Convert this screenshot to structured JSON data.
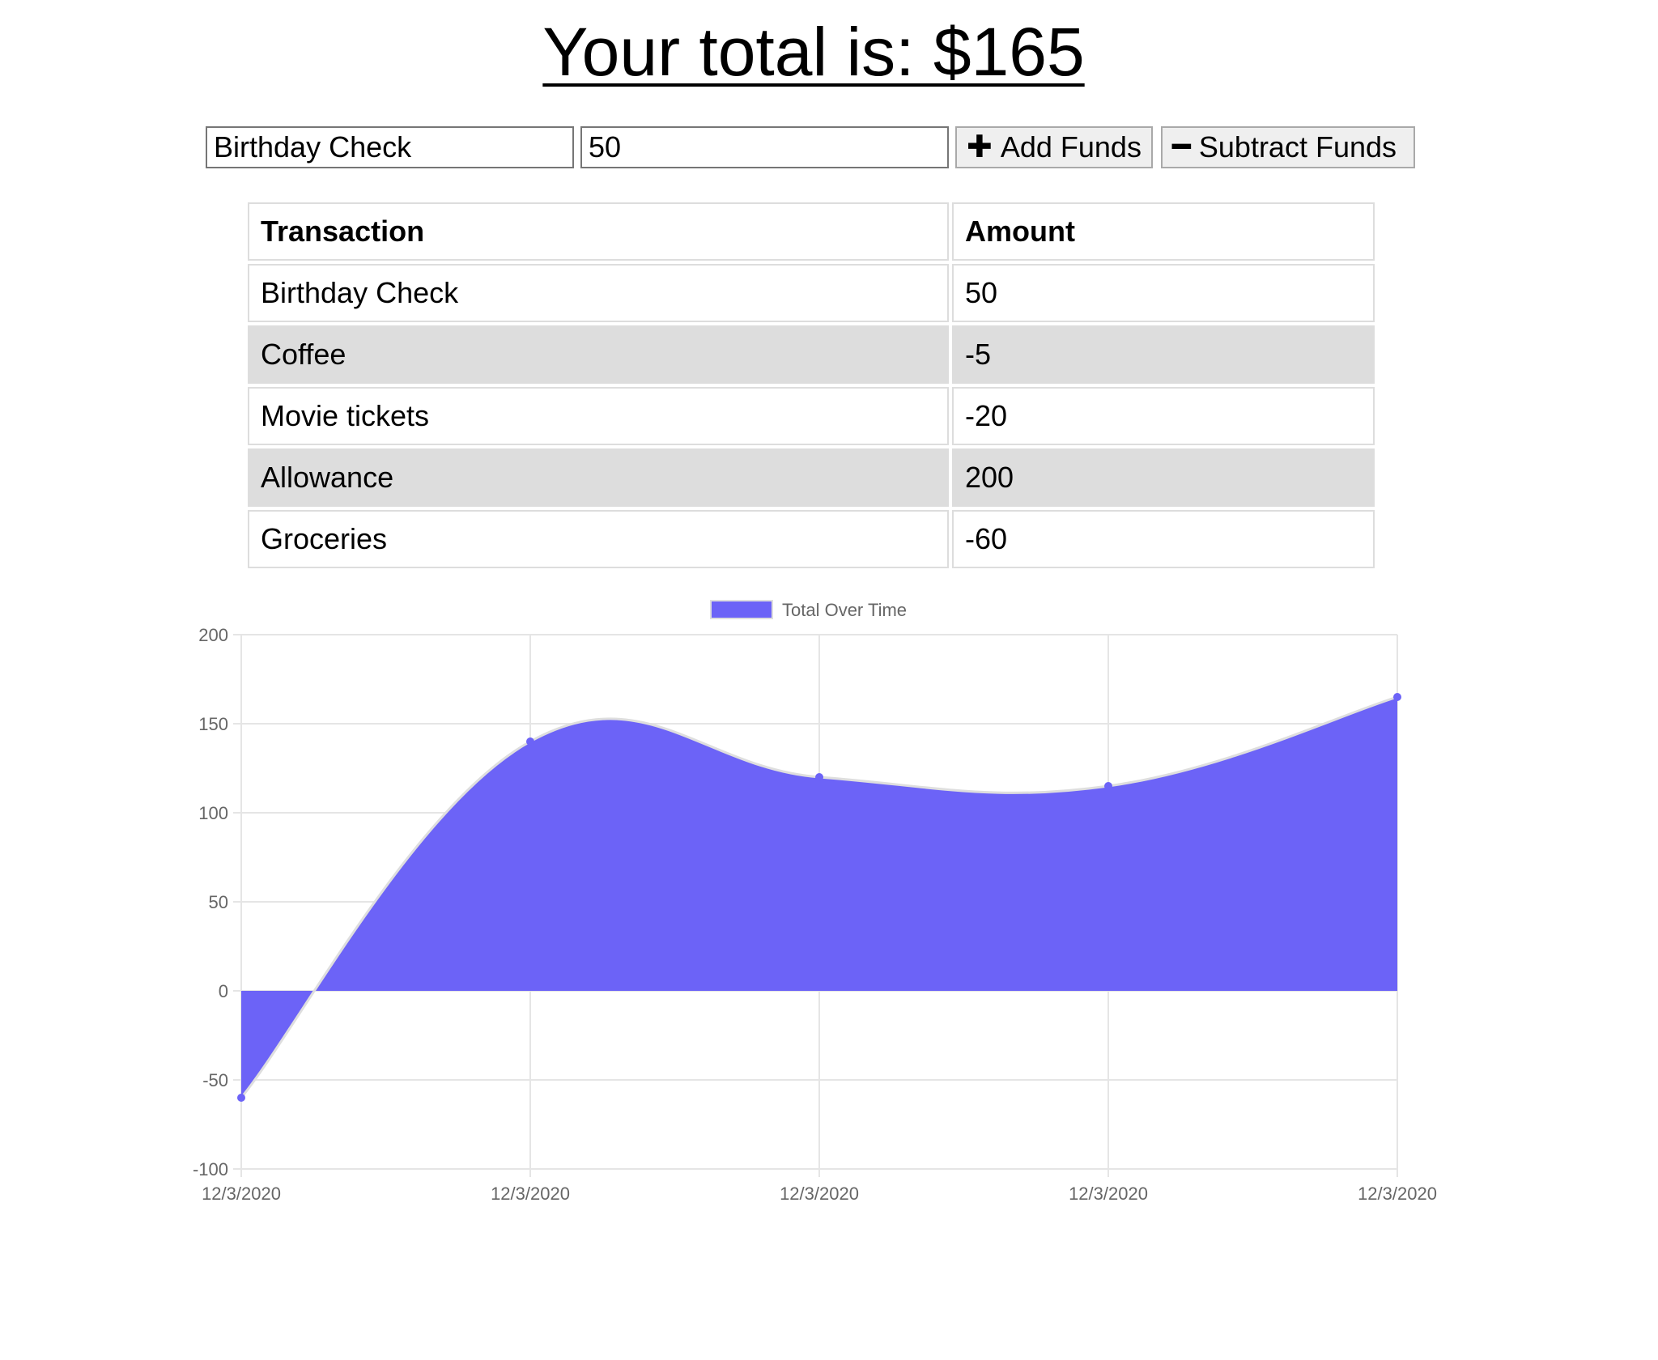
{
  "header": {
    "total_label": "Your total is: $165"
  },
  "form": {
    "name_value": "Birthday Check",
    "amount_value": "50",
    "add_label": "Add Funds",
    "subtract_label": "Subtract Funds"
  },
  "table": {
    "headers": [
      "Transaction",
      "Amount"
    ],
    "rows": [
      [
        "Birthday Check",
        "50"
      ],
      [
        "Coffee",
        "-5"
      ],
      [
        "Movie tickets",
        "-20"
      ],
      [
        "Allowance",
        "200"
      ],
      [
        "Groceries",
        "-60"
      ]
    ]
  },
  "colors": {
    "series_fill": "#6c63f7",
    "series_point": "#6c63f7",
    "series_line": "#dedede",
    "grid": "#e5e5e5",
    "tick_text": "#666666",
    "row_stripe": "#dddddd"
  },
  "icons": {
    "add": "plus-icon",
    "subtract": "minus-icon"
  },
  "chart_data": {
    "type": "area",
    "legend": "top-center",
    "grid": true,
    "x": [
      "12/3/2020",
      "12/3/2020",
      "12/3/2020",
      "12/3/2020",
      "12/3/2020"
    ],
    "series": [
      {
        "name": "Total Over Time",
        "values": [
          -60,
          140,
          120,
          115,
          165
        ]
      }
    ],
    "ylim": [
      -100,
      200
    ],
    "yticks": [
      200,
      150,
      100,
      50,
      0,
      -50,
      -100
    ]
  }
}
